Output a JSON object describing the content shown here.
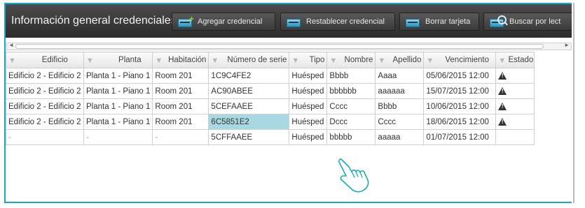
{
  "toolbar": {
    "title": "Información general credenciales",
    "add_label": "Agregar credencial",
    "reset_label": "Restablecer credencial",
    "delete_label": "Borrar tarjeta",
    "search_label": "Buscar por lect"
  },
  "table": {
    "columns": [
      "Edificio",
      "Planta",
      "Habitación",
      "Número de serie",
      "Tipo",
      "Nombre",
      "Apellido",
      "Vencimiento",
      "Estado"
    ],
    "rows": [
      [
        "Edificio 2 - Edificio 2",
        "Planta 1 - Piano 1",
        "Room 201",
        "1C9C4FE2",
        "Huésped",
        "Bbbb",
        "Aaaa",
        "05/06/2015 12:00",
        "warning"
      ],
      [
        "Edificio 2 - Edificio 2",
        "Planta 1 - Piano 1",
        "Room 201",
        "AC90ABEE",
        "Huésped",
        "bbbbbb",
        "aaaaaa",
        "15/07/2015 12:00",
        "warning"
      ],
      [
        "Edificio 2 - Edificio 2",
        "Planta 1 - Piano 1",
        "Room 201",
        "5CEFAAEE",
        "Huésped",
        "Cccc",
        "Bbbb",
        "10/06/2015 12:00",
        "warning"
      ],
      [
        "Edificio 2 - Edificio 2",
        "Planta 1 - Piano 1",
        "Room 201",
        "6C5851E2",
        "Huésped",
        "Dccc",
        "Cccc",
        "18/06/2015 12:00",
        "warning"
      ],
      [
        "-",
        "-",
        "-",
        "5CFFAAEE",
        "Huésped",
        "bbbbb",
        "aaaaa",
        "01/07/2015 12:00",
        ""
      ]
    ]
  },
  "icons": {
    "add": "add-card-icon",
    "reset": "reset-card-icon",
    "delete": "delete-card-icon",
    "search": "search-reader-icon",
    "filter": "filter-icon",
    "status_warning": "warning-icon",
    "pointer": "hand-pointer-icon"
  },
  "colors": {
    "accent_border": "#18a9c4",
    "toolbar_bg": "#3a3a3a",
    "selected_cell": "#a8d9e2"
  }
}
